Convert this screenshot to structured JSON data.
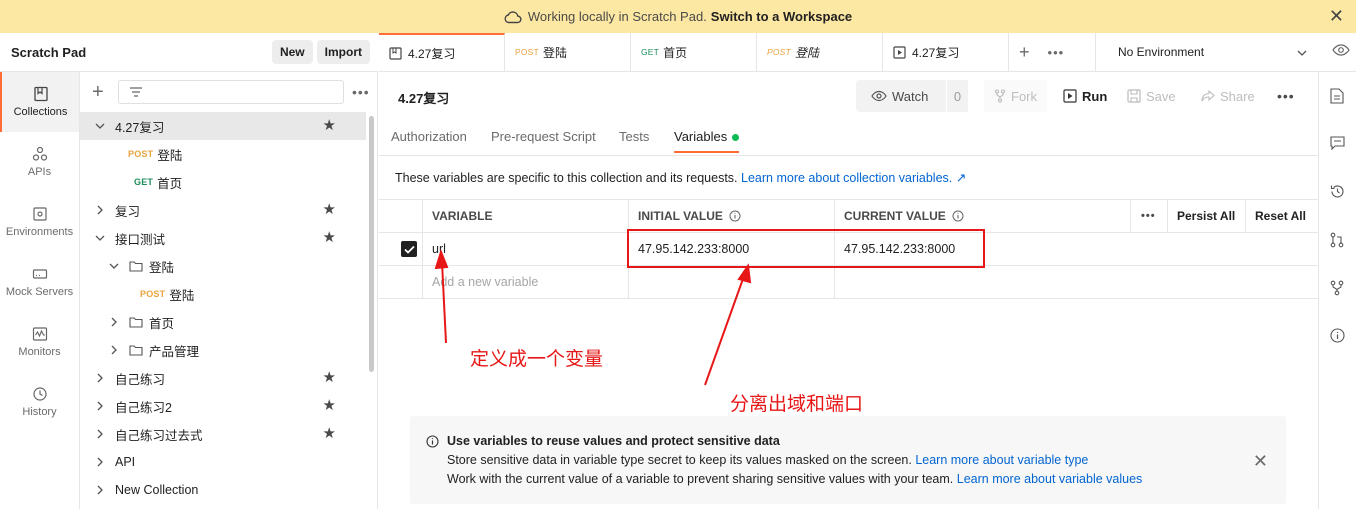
{
  "banner": {
    "text": "Working locally in Scratch Pad.",
    "link": "Switch to a Workspace",
    "close": "✕"
  },
  "workspace": {
    "title": "Scratch Pad",
    "new_label": "New",
    "import_label": "Import"
  },
  "rail": [
    {
      "label": "Collections",
      "icon": "collections-icon"
    },
    {
      "label": "APIs",
      "icon": "apis-icon"
    },
    {
      "label": "Environments",
      "icon": "environments-icon"
    },
    {
      "label": "Mock Servers",
      "icon": "mock-servers-icon"
    },
    {
      "label": "Monitors",
      "icon": "monitors-icon"
    },
    {
      "label": "History",
      "icon": "history-icon"
    }
  ],
  "tree": {
    "items": [
      {
        "name": "4.27复习",
        "method": "",
        "starred": true,
        "expanded": true
      },
      {
        "name": "登陆",
        "method": "POST"
      },
      {
        "name": "首页",
        "method": "GET"
      },
      {
        "name": "复习",
        "starred": true
      },
      {
        "name": "接口测试",
        "starred": true,
        "expanded": true
      },
      {
        "name": "登陆",
        "folder": true,
        "expanded": true
      },
      {
        "name": "登陆",
        "method": "POST"
      },
      {
        "name": "首页",
        "folder": true
      },
      {
        "name": "产品管理",
        "folder": true
      },
      {
        "name": "自己练习",
        "starred": true
      },
      {
        "name": "自己练习2",
        "starred": true
      },
      {
        "name": "自己练习过去式",
        "starred": true
      },
      {
        "name": "API"
      },
      {
        "name": "New Collection"
      }
    ]
  },
  "tabs": [
    {
      "label": "4.27复习",
      "method": "",
      "active": true
    },
    {
      "label": "登陆",
      "method": "POST"
    },
    {
      "label": "首页",
      "method": "GET"
    },
    {
      "label": "登陆",
      "method": "POST"
    },
    {
      "label": "4.27复习",
      "method": ""
    }
  ],
  "environment": "No Environment",
  "main": {
    "title": "4.27复习",
    "watch_label": "Watch",
    "watch_count": "0",
    "fork_label": "Fork",
    "run_label": "Run",
    "save_label": "Save",
    "share_label": "Share"
  },
  "subtabs": [
    "Authorization",
    "Pre-request Script",
    "Tests",
    "Variables"
  ],
  "description": {
    "text": "These variables are specific to this collection and its requests.",
    "link": "Learn more about collection variables. ↗"
  },
  "variables": {
    "headers": {
      "variable": "VARIABLE",
      "initial": "INITIAL VALUE",
      "current": "CURRENT VALUE",
      "persist": "Persist All",
      "reset": "Reset All"
    },
    "rows": [
      {
        "checked": true,
        "name": "url",
        "initial": "47.95.142.233:8000",
        "current": "47.95.142.233:8000"
      }
    ],
    "new_placeholder": "Add a new variable"
  },
  "annotations": {
    "left": "定义成一个变量",
    "right": "分离出域和端口",
    "color": "#e81717"
  },
  "info": {
    "title": "Use variables to reuse values and protect sensitive data",
    "line1": "Store sensitive data in variable type secret to keep its values masked on the screen.",
    "line1_link": "Learn more about variable type",
    "line2": "Work with the current value of a variable to prevent sharing sensitive values with your team.",
    "line2_link": "Learn more about variable values"
  },
  "colors": {
    "accent": "#ff6c37",
    "post": "#e8a33d",
    "get": "#1f8e5c",
    "link": "#0265d2",
    "banner": "#fde8a3"
  }
}
